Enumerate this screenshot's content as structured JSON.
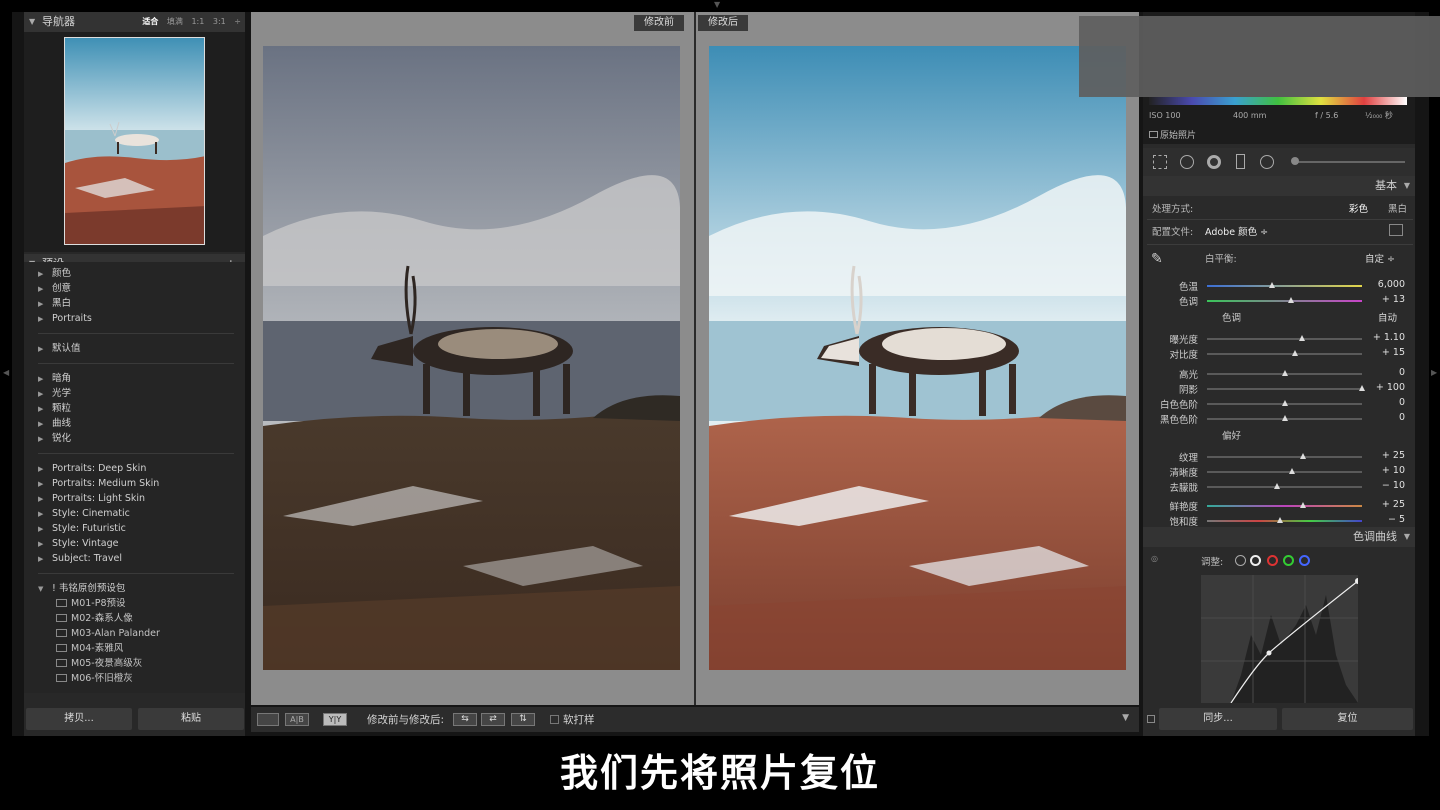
{
  "navigator": {
    "title": "导航器",
    "zoom_options": [
      "适合",
      "填满",
      "1:1",
      "3:1"
    ]
  },
  "presets": {
    "title": "预设",
    "add_symbol": "+.",
    "groups": [
      [
        "颜色",
        "创意",
        "黑白",
        "Portraits"
      ],
      [
        "默认值"
      ],
      [
        "暗角",
        "光学",
        "颗粒",
        "曲线",
        "锐化"
      ],
      [
        "Portraits: Deep Skin",
        "Portraits: Medium Skin",
        "Portraits: Light Skin",
        "Style: Cinematic",
        "Style: Futuristic",
        "Style: Vintage",
        "Subject: Travel"
      ]
    ],
    "open_group": "! 韦铭原创预设包",
    "open_group_items": [
      "M01-P8预设",
      "M02-森系人像",
      "M03-Alan Palander",
      "M04-素雅风",
      "M05-夜景高级灰",
      "M06-怀旧橙灰"
    ]
  },
  "left_buttons": {
    "copy": "拷贝...",
    "paste": "粘贴"
  },
  "view": {
    "before_label": "修改前",
    "after_label": "修改后"
  },
  "toolbar": {
    "view_ab": "A|B",
    "view_yy": "Y|Y",
    "before_after_label": "修改前与修改后:",
    "softproof_label": "软打样"
  },
  "histogram_info": {
    "iso": "ISO 100",
    "focal": "400 mm",
    "aperture": "f / 5.6",
    "shutter": "¹⁄₂₀₀₀ 秒",
    "original_photo": "原始照片"
  },
  "basic": {
    "section_title": "基本",
    "treatment_label": "处理方式:",
    "treatment_color": "彩色",
    "treatment_bw": "黑白",
    "profile_label": "配置文件:",
    "profile_value": "Adobe 颜色 ÷",
    "wb_label": "白平衡:",
    "wb_value": "自定 ÷",
    "tone_label": "色调",
    "tone_auto": "自动",
    "presence_label": "偏好",
    "sliders": {
      "temp": {
        "label": "色温",
        "value": "6,000",
        "pos": 0.42
      },
      "tint": {
        "label": "色调",
        "value": "+ 13",
        "pos": 0.54
      },
      "exposure": {
        "label": "曝光度",
        "value": "+ 1.10",
        "pos": 0.61
      },
      "contrast": {
        "label": "对比度",
        "value": "+ 15",
        "pos": 0.57
      },
      "highlights": {
        "label": "高光",
        "value": "0",
        "pos": 0.5
      },
      "shadows": {
        "label": "阴影",
        "value": "+ 100",
        "pos": 1.0
      },
      "whites": {
        "label": "白色色阶",
        "value": "0",
        "pos": 0.5
      },
      "blacks": {
        "label": "黑色色阶",
        "value": "0",
        "pos": 0.5
      },
      "texture": {
        "label": "纹理",
        "value": "+ 25",
        "pos": 0.62
      },
      "clarity": {
        "label": "清晰度",
        "value": "+ 10",
        "pos": 0.55
      },
      "dehaze": {
        "label": "去朦胧",
        "value": "− 10",
        "pos": 0.45
      },
      "vibrance": {
        "label": "鲜艳度",
        "value": "+ 25",
        "pos": 0.62
      },
      "saturation": {
        "label": "饱和度",
        "value": "− 5",
        "pos": 0.47
      }
    }
  },
  "tone_curve": {
    "section_title": "色调曲线",
    "adjust_label": "调整:"
  },
  "right_buttons": {
    "sync": "同步...",
    "reset": "复位"
  },
  "subtitle": "我们先将照片复位",
  "colors": {
    "panel_bg": "#282828",
    "center_bg": "#8c8c8c",
    "accent_white": "#ffffff"
  }
}
